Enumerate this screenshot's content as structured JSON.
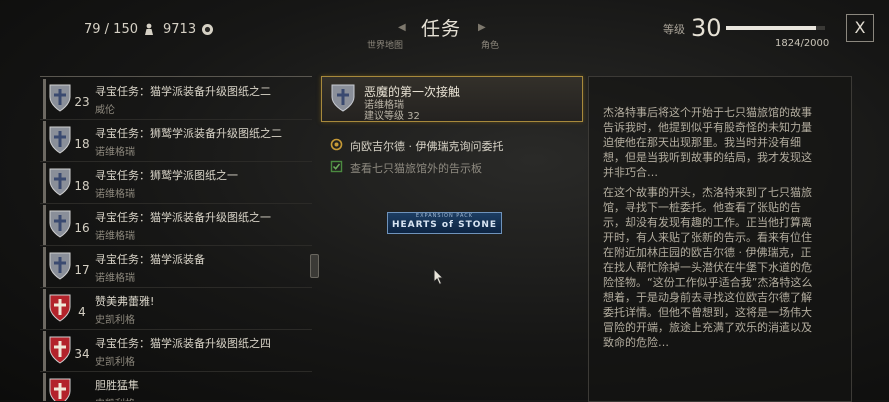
{
  "topbar": {
    "inventory": "79 / 150",
    "money": "9713",
    "nav_title": "任务",
    "nav_left": "世界地图",
    "nav_right": "角色",
    "level_label": "等级",
    "level": "30",
    "xp_text": "1824/2000",
    "xp_fraction": 0.912,
    "close": "X"
  },
  "quests": [
    {
      "title": "寻宝任务：猫学派装备升级图纸之二",
      "sub": "威伦",
      "level": "23",
      "shield": "silver"
    },
    {
      "title": "寻宝任务：狮鹫学派装备升级图纸之二",
      "sub": "诺维格瑞",
      "level": "18",
      "shield": "silver"
    },
    {
      "title": "寻宝任务：狮鹫学派图纸之一",
      "sub": "诺维格瑞",
      "level": "18",
      "shield": "silver"
    },
    {
      "title": "寻宝任务：猫学派装备升级图纸之一",
      "sub": "诺维格瑞",
      "level": "16",
      "shield": "silver"
    },
    {
      "title": "寻宝任务：猫学派装备",
      "sub": "诺维格瑞",
      "level": "17",
      "shield": "silver"
    },
    {
      "title": "赞美弗蕾雅!",
      "sub": "史凯利格",
      "level": "4",
      "shield": "red"
    },
    {
      "title": "寻宝任务：猫学派装备升级图纸之四",
      "sub": "史凯利格",
      "level": "34",
      "shield": "red"
    },
    {
      "title": "胆胜猛隼",
      "sub": "史凯利格",
      "level": "",
      "shield": "red"
    }
  ],
  "selected": {
    "title": "恶魔的第一次接触",
    "region": "诺维格瑞",
    "level_text": "建议等级 32"
  },
  "objectives": [
    {
      "text": "向欧吉尔德 · 伊佛瑞克询问委托"
    },
    {
      "text": "查看七只猫旅馆外的告示板"
    }
  ],
  "badge": {
    "top": "EXPANSION PACK",
    "main": "HEARTS of STONE"
  },
  "description": {
    "p1": "杰洛特事后将这个开始于七只猫旅馆的故事告诉我时，他提到似乎有股奇怪的未知力量迫使他在那天出现那里。我当时并没有细想，但是当我听到故事的结局，我才发现这并非巧合…",
    "p2": "在这个故事的开头，杰洛特来到了七只猫旅馆，寻找下一桩委托。他查看了张贴的告示，却没有发现有趣的工作。正当他打算离开时，有人来贴了张新的告示。看来有位住在附近加林庄园的欧吉尔德 · 伊佛瑞克，正在找人帮忙除掉一头潜伏在牛堡下水道的危险怪物。“这份工作似乎适合我”杰洛特这么想着，于是动身前去寻找这位欧吉尔德了解委托详情。但他不曾想到，这将是一场伟大冒险的开端，旅途上充满了欢乐的消遣以及致命的危险…"
  },
  "colors": {
    "accent_gold": "#a7893c",
    "shield_silver": "#8a8f99",
    "shield_red": "#b3232b"
  }
}
